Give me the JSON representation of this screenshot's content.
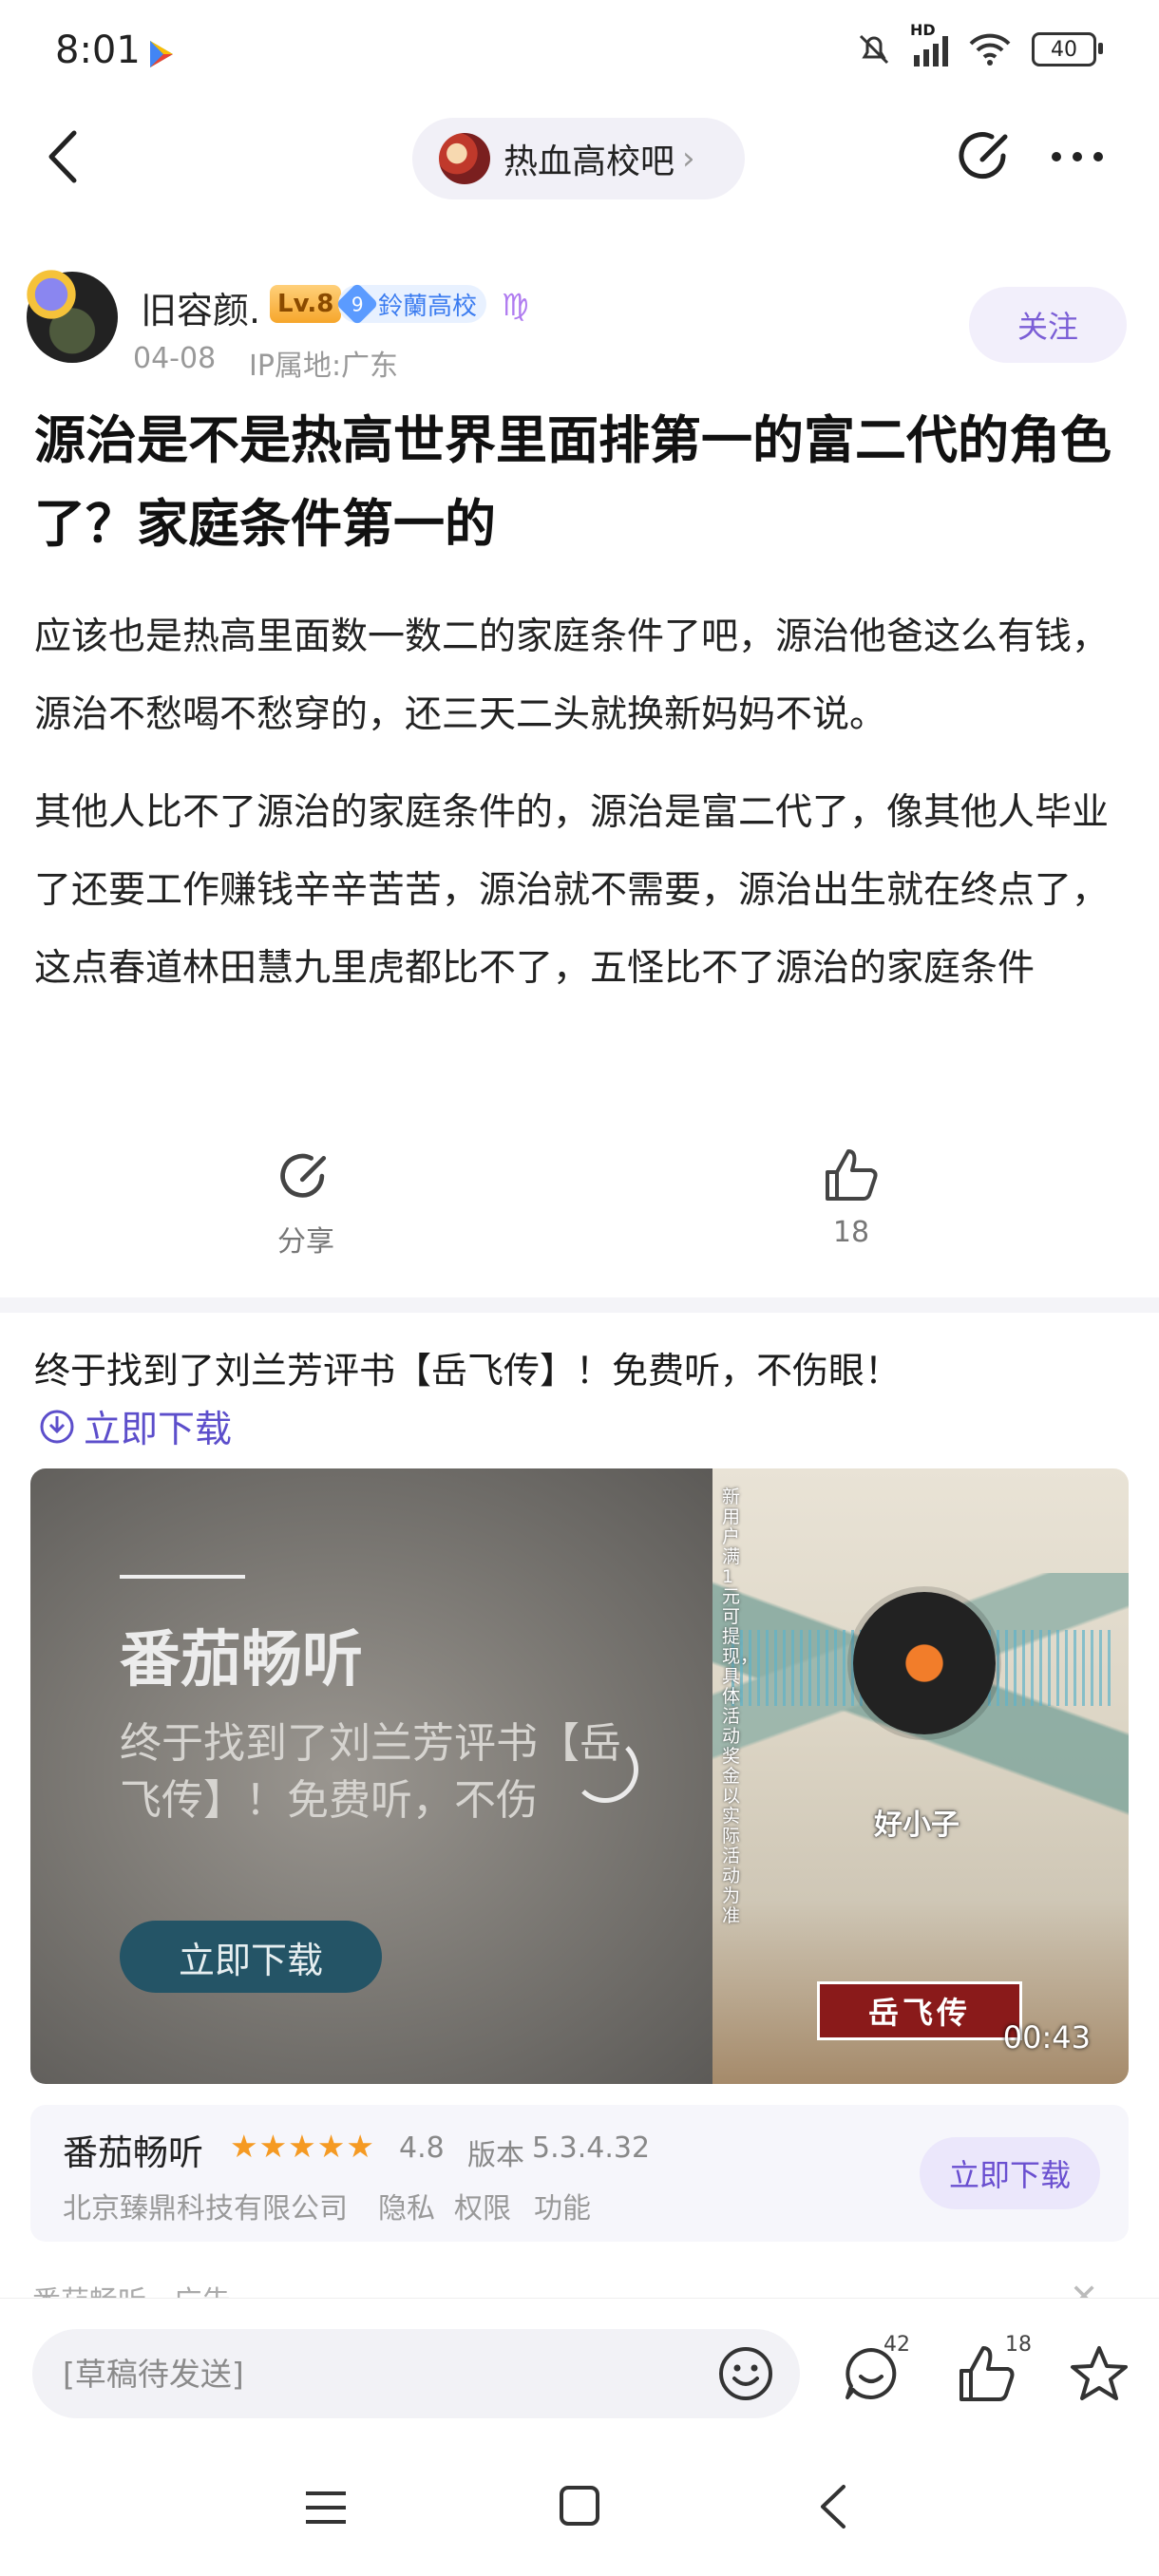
{
  "status_bar": {
    "time": "8:01",
    "network": "HD",
    "battery": "40"
  },
  "header": {
    "forum_name": "热血高校吧"
  },
  "author": {
    "name": "旧容颜.",
    "level": "Lv.8",
    "club_level": "9",
    "club_name": "鈴蘭高校",
    "date": "04-08",
    "ip": "IP属地:广东",
    "follow_label": "关注"
  },
  "post": {
    "title": "源治是不是热高世界里面排第一的富二代的角色了？家庭条件第一的",
    "paragraphs": [
      "应该也是热高里面数一数二的家庭条件了吧，源治他爸这么有钱，源治不愁喝不愁穿的，还三天二头就换新妈妈不说。",
      "其他人比不了源治的家庭条件的，源治是富二代了，像其他人毕业了还要工作赚钱辛辛苦苦，源治就不需要，源治出生就在终点了，这点春道林田慧九里虎都比不了，五怪比不了源治的家庭条件"
    ],
    "share_label": "分享",
    "like_count": "18"
  },
  "ad": {
    "title": "终于找到了刘兰芳评书【岳飞传】！免费听，不伤眼！",
    "download_link": "立即下载",
    "media": {
      "brand": "番茄畅听",
      "description": "终于找到了刘兰芳评书【岳飞传】！免费听，不伤",
      "cta": "立即下载",
      "vertical_text": "新用户满1元可提现，具体活动奖金以实际活动为准",
      "song_title": "好小子",
      "stamp": "岳飞传",
      "duration": "00:43"
    },
    "app": {
      "name": "番茄畅听",
      "stars": "★★★★★",
      "rating": "4.8",
      "version_label": "版本",
      "version": "5.3.4.32",
      "company": "北京臻鼎科技有限公司",
      "privacy": "隐私",
      "permissions": "权限",
      "features": "功能",
      "download": "立即下载"
    },
    "source": "番茄畅听 · 广告"
  },
  "bottom_bar": {
    "draft_placeholder": "[草稿待发送]",
    "comment_count": "42",
    "like_count": "18"
  },
  "colors": {
    "accent": "#7b5ed6",
    "star": "#f59a23",
    "link": "#5c4ecb"
  }
}
